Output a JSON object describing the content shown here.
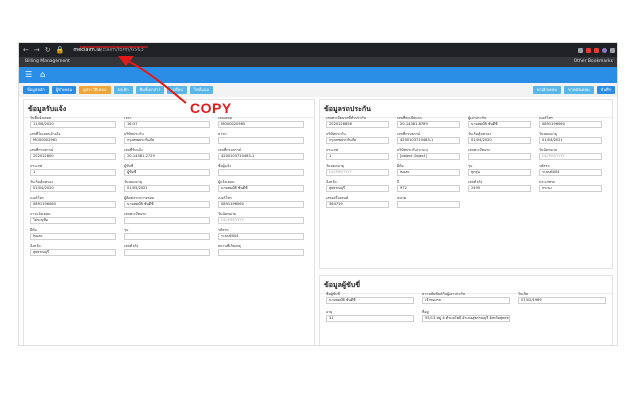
{
  "browser": {
    "url_host": "meclaim.ia",
    "url_path": "/claim/form/6563",
    "bookmarks_left": "Billing Management",
    "bookmarks_right": "Other Bookmarks"
  },
  "annotation": {
    "label": "COPY",
    "color": "#e11b1b"
  },
  "toolbar": {
    "buttons": [
      {
        "label": "ข้อมูลหลัก",
        "color": "#2b8ee6"
      },
      {
        "label": "ผู้ทำเคลม",
        "color": "#2b8ee6"
      },
      {
        "label": "ดูประวัติเคลม",
        "color": "#f0a53b"
      },
      {
        "label": "ยกเลิก",
        "color": "#58b6e8"
      },
      {
        "label": "พิมพ์เอกสาร",
        "color": "#58b6e8"
      },
      {
        "label": "เปลี่ยน",
        "color": "#58b6e8"
      },
      {
        "label": "ไฟล์แนบ",
        "color": "#58b6e8"
      }
    ],
    "right_buttons": [
      {
        "label": "ยกเลิกเคลม",
        "color": "#58b6e8"
      },
      {
        "label": "ขาดต่อเคลม",
        "color": "#58b6e8"
      },
      {
        "label": "บันทึก",
        "color": "#2b8ee6"
      }
    ]
  },
  "left_panel": {
    "title": "ข้อมูลรับแจ้ง",
    "fields": [
      {
        "label": "วันที่แจ้งเคลม",
        "value": "11/06/2020"
      },
      {
        "label": "เวลา",
        "value": "16:37"
      },
      {
        "label": "เลขเคลม",
        "value": "MO00020565"
      },
      {
        "label": "เลขที่ใบเคลมอ้างอิง",
        "value": "MO00002961"
      },
      {
        "label": "บริษัทประกัน",
        "value": "กรุงเทพประกันภัย"
      },
      {
        "label": "สาขา",
        "value": ""
      },
      {
        "label": "เลขที่กรมธรรม์",
        "value": "202012800"
      },
      {
        "label": "เลขที่รับแจ้ง",
        "value": "20-14381-2729"
      },
      {
        "label": "เลขที่กรมธรรม์",
        "value": "4200103710483-1"
      },
      {
        "label": "ประเภท",
        "value": "1"
      },
      {
        "label": "ผู้ขับขี่",
        "value": "ผู้ขับขี่"
      },
      {
        "label": "ชื่อผู้แจ้ง",
        "value": ""
      },
      {
        "label": "วันเริ่มคุ้มครอง",
        "value": "01/04/2020"
      },
      {
        "label": "วันหมดอายุ",
        "value": "01/05/2021"
      },
      {
        "label": "ผู้แจ้งเคลม",
        "value": "นายสมบัติ ชันดีชี"
      },
      {
        "label": "เบอร์โทร",
        "value": "0891196060"
      },
      {
        "label": "ผู้ติดต่อระหว่างซ่อม",
        "value": "นายสมบัติ ชันดีชี"
      },
      {
        "label": "เบอร์โทร",
        "value": "0891196060"
      },
      {
        "label": "การแจ้งเคลม",
        "value": "ไม่ระบุชื่อ"
      },
      {
        "label": "เลขทะเบียนรถ",
        "value": ""
      },
      {
        "label": "วันนัดหมาย",
        "value": "DD/MM/YYYY"
      },
      {
        "label": "ยี่ห้อ",
        "value": "Isuzu"
      },
      {
        "label": "รุ่น",
        "value": ""
      },
      {
        "label": "รหัสรถ",
        "value": "ระบบ6004"
      },
      {
        "label": "จังหวัด",
        "value": "สุพรรณบุรี"
      },
      {
        "label": "เลขตัวถัง",
        "value": ""
      },
      {
        "label": "สถานที่เกิดเหตุ",
        "value": ""
      }
    ]
  },
  "right_panel": {
    "title": "ข้อมูลรถประกัน",
    "fields": [
      {
        "label": "เลขทะเบียนรถที่ทำประกัน",
        "value": "2020128656"
      },
      {
        "label": "เลขที่ทะเบียนรถ",
        "value": "20-14381-8789"
      },
      {
        "label": "ผู้เอาประกัน",
        "value": "นายสมบัติ ชันดีชี"
      },
      {
        "label": "เบอร์โทร",
        "value": "0891196060"
      },
      {
        "label": "บริษัทประกัน",
        "value": "กรุงเทพประกันภัย"
      },
      {
        "label": "เลขที่กรมธรรม์",
        "value": "4200103710483-1"
      },
      {
        "label": "วันเริ่มคุ้มครอง",
        "value": "01/04/2020"
      },
      {
        "label": "วันหมดอายุ",
        "value": "01/04/2021"
      },
      {
        "label": "ประเภท",
        "value": "1"
      },
      {
        "label": "บริษัทประกัน(ระบบ)",
        "value": "[object Object]"
      },
      {
        "label": "เลขทะเบียนรถ",
        "value": ""
      },
      {
        "label": "วันนัดหมาย",
        "value": "DD/MM/YYYY"
      },
      {
        "label": "วันหมดอายุ",
        "value": "DD/MM/YYYY"
      },
      {
        "label": "ยี่ห้อ",
        "value": "Isuzu"
      },
      {
        "label": "รุ่น",
        "value": "ทุกรุ่น"
      },
      {
        "label": "รหัสรถ",
        "value": "ระบบ6004"
      },
      {
        "label": "จังหวัด",
        "value": "สุพรรณบุรี"
      },
      {
        "label": "ปี",
        "value": "972"
      },
      {
        "label": "เลขตัวถัง",
        "value": "2495"
      },
      {
        "label": "ประเภทรถ",
        "value": "กระบะ"
      },
      {
        "label": "เลขเครื่องยนต์",
        "value": "364719"
      },
      {
        "label": "ขนาด",
        "value": ""
      }
    ]
  },
  "driver_panel": {
    "title": "ข้อมูลผู้ขับขี่",
    "fields": [
      {
        "label": "ชื่อผู้ขับขี่",
        "value": "นายสมบัติ ชันดีชี"
      },
      {
        "label": "ความสัมพันธ์กับผู้เอาประกัน",
        "value": "เจ้าของรถ"
      },
      {
        "label": "วันเกิด",
        "value": "07/02/1989"
      },
      {
        "label": "อายุ",
        "value": "31"
      },
      {
        "label": "ที่อยู่",
        "value": "55/13 หมู่ 4 ตำบลโพธิ์ อำเภอสุพรรณบุรี จังหวัดสุพรรณบุรี"
      }
    ]
  }
}
